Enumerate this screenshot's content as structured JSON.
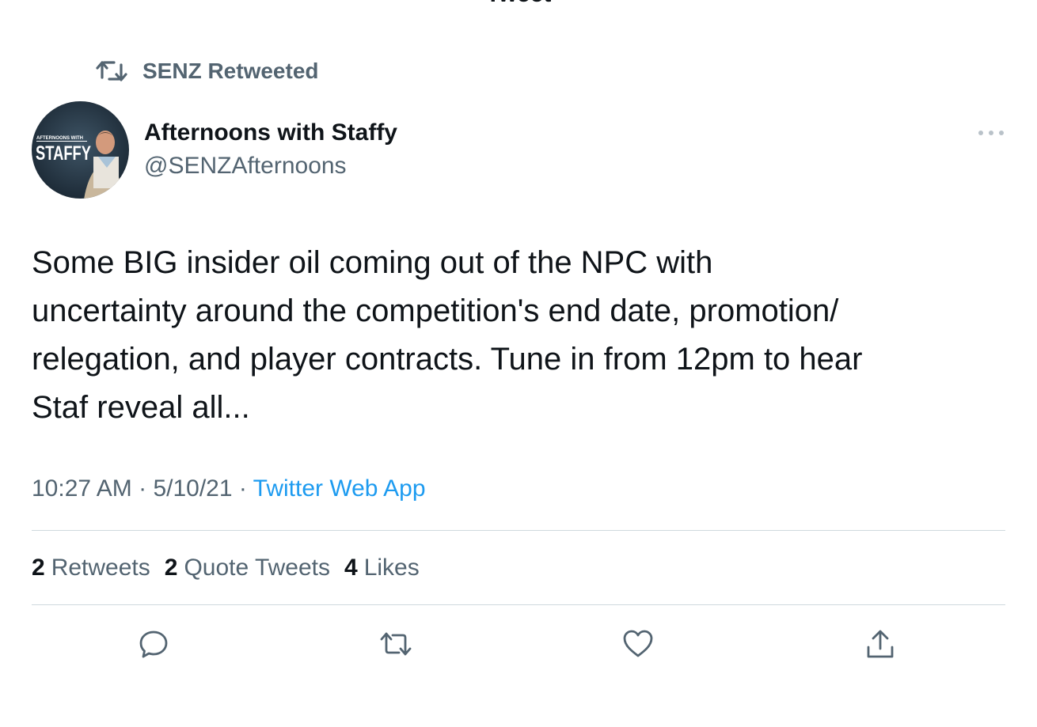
{
  "header": {
    "title": "Tweet",
    "back_icon": "back-arrow-icon"
  },
  "retweet_context": {
    "icon": "retweet-icon",
    "label": "SENZ Retweeted"
  },
  "author": {
    "name": "Afternoons with Staffy",
    "handle": "@SENZAfternoons",
    "avatar_text_small": "AFTERNOONS WITH",
    "avatar_text_big": "STAFFY"
  },
  "tweet": {
    "text": "Some BIG insider oil coming out of the NPC with\nuncertainty around the competition's end date, promotion/\nrelegation, and player contracts. Tune in from 12pm to hear\nStaf reveal all...",
    "time": "10:27 AM",
    "date": "5/10/21",
    "separator": " · ",
    "source": "Twitter Web App"
  },
  "stats": {
    "retweets_count": "2",
    "retweets_label": "Retweets",
    "quotes_count": "2",
    "quotes_label": "Quote Tweets",
    "likes_count": "4",
    "likes_label": "Likes"
  },
  "actions": [
    {
      "name": "reply",
      "icon": "reply-icon"
    },
    {
      "name": "retweet",
      "icon": "retweet-icon"
    },
    {
      "name": "like",
      "icon": "heart-icon"
    },
    {
      "name": "share",
      "icon": "share-icon"
    }
  ],
  "colors": {
    "text_primary": "#0f1419",
    "text_secondary": "#536471",
    "link": "#1d9bf0",
    "divider": "#cfd9de"
  }
}
